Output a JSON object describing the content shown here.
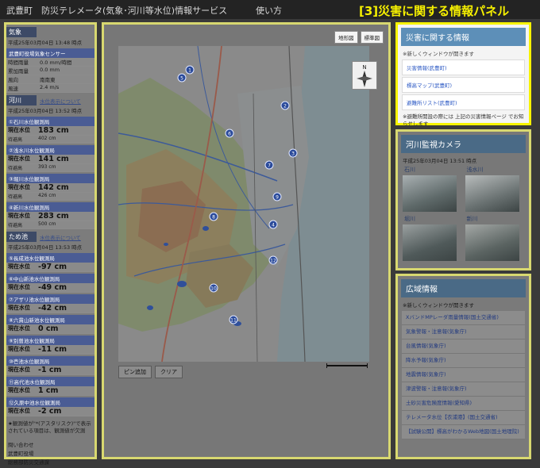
{
  "header": {
    "title": "武豊町　防災テレメータ(気象･河川等水位)情報サービス",
    "help": "使い方",
    "caption": "[3]災害に関する情報パネル"
  },
  "left": {
    "weather": {
      "head": "気象",
      "time": "平成25年03月04日 13:48 時点",
      "station": "武豊町役場気象センサー",
      "rows": [
        {
          "k": "時間雨量",
          "v": "0.0 mm/時間"
        },
        {
          "k": "累加雨量",
          "v": "0.0 mm"
        },
        {
          "k": "風向",
          "v": "南南東"
        },
        {
          "k": "風速",
          "v": "2.4 m/s"
        }
      ]
    },
    "river": {
      "head": "河川",
      "link": "水位表示について",
      "time": "平成25年03月04日 13:52 時点",
      "stations": [
        {
          "name": "①石川水位観測局",
          "label": "現在水位",
          "value": "183 cm",
          "sub_k": "待避高",
          "sub_v": "402 cm"
        },
        {
          "name": "②浅水川水位観測局",
          "label": "現在水位",
          "value": "141 cm",
          "sub_k": "待避高",
          "sub_v": "393 cm"
        },
        {
          "name": "③堀川水位観測局",
          "label": "現在水位",
          "value": "142 cm",
          "sub_k": "待避高",
          "sub_v": "426 cm"
        },
        {
          "name": "④新川水位観測局",
          "label": "現在水位",
          "value": "283 cm",
          "sub_k": "待避高",
          "sub_v": "500 cm"
        }
      ]
    },
    "pond": {
      "head": "ため池",
      "link": "水位表示について",
      "time": "平成25年03月04日 13:53 時点",
      "stations": [
        {
          "name": "⑤長成池水位観測局",
          "label": "現在水位",
          "value": "-97 cm"
        },
        {
          "name": "⑥中山新池水位観測局",
          "label": "現在水位",
          "value": "-49 cm"
        },
        {
          "name": "⑦アザリ池水位観測局",
          "label": "現在水位",
          "value": "-42 cm"
        },
        {
          "name": "⑧六貫山新池水位観測局",
          "label": "現在水位",
          "value": "0 cm"
        },
        {
          "name": "⑨別曽池水位観測局",
          "label": "現在水位",
          "value": "-11 cm"
        },
        {
          "name": "⑩壱池水位観測局",
          "label": "現在水位",
          "value": "-1 cm"
        },
        {
          "name": "⑪高代池水位観測局",
          "label": "現在水位",
          "value": "1 cm"
        },
        {
          "name": "⑫久原中池水位観測局",
          "label": "現在水位",
          "value": "-2 cm"
        }
      ]
    },
    "note": "★観測値が\"*(アスタリスク)\"で表示されている項目は、観測値が欠測",
    "contact": {
      "lines": [
        "問い合わせ",
        "武豊町役場",
        "総務部防災交通課",
        "TEL:(0569)72-1111",
        "FAX:(0569)72-1115"
      ]
    }
  },
  "map": {
    "buttons": [
      "地形図",
      "標準図"
    ],
    "tools": [
      "ピン追加",
      "クリア"
    ],
    "compass_icon": "compass-icon",
    "station_marks": [
      "1",
      "2",
      "3",
      "4",
      "5",
      "6",
      "7",
      "8",
      "9",
      "10",
      "11",
      "12"
    ]
  },
  "disaster": {
    "title": "災害に関する情報",
    "note": "※新しくウィンドウが開きます",
    "links": [
      "災害情報(武豊町)",
      "標高マップ(武豊町)",
      "避難所リスト(武豊町)"
    ],
    "footer": "※避難所開設の際には 上記の災害情報ページ でお知らせします"
  },
  "camera": {
    "title": "河川監視カメラ",
    "time": "平成25年03月04日 13:51 時点",
    "cams": [
      "石川",
      "浅水川",
      "堀川",
      "新川"
    ]
  },
  "wide": {
    "title": "広域情報",
    "note": "※新しくウィンドウが開きます",
    "links": [
      "XバンドMPレーダ雨量情報(国土交通省)",
      "気象警報・注意報(気象庁)",
      "台風情報(気象庁)",
      "降水予報(気象庁)",
      "地震情報(気象庁)",
      "津波警報・注意報(気象庁)",
      "土砂災害危険度情報(愛知県)",
      "テレメータ水位【衣浦港】(国土交通省)",
      "【試験公開】標高がわかるWeb地図(国土地理院)"
    ]
  }
}
